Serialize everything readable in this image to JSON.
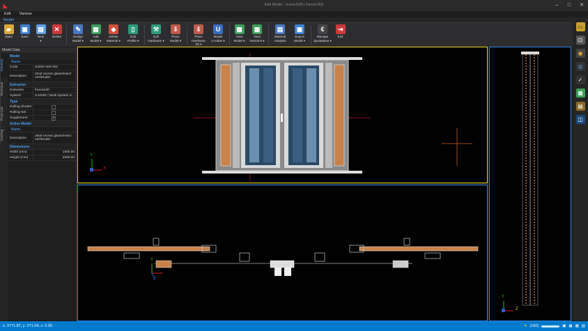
{
  "window": {
    "title": "Edit Model - frameSoft | frameCAD",
    "controls": [
      "–",
      "□",
      "✕"
    ]
  },
  "menu": [
    "Edit",
    "Various"
  ],
  "ribbon_tab": "Model",
  "ribbon": [
    {
      "label": "Open",
      "icon": "folder-icon",
      "color": "#d9a53a",
      "glyph": "▰"
    },
    {
      "label": "Save",
      "icon": "save-icon",
      "color": "#3b7fd4",
      "glyph": "▣"
    },
    {
      "label": "New\n▾",
      "icon": "new-icon",
      "color": "#5f9ee6",
      "glyph": "▤"
    },
    {
      "label": "Delete",
      "icon": "delete-icon",
      "color": "#c93b3b",
      "glyph": "✕"
    },
    {
      "label": "Design\nModel ▾",
      "icon": "design-model-icon",
      "color": "#4a78c2",
      "glyph": "✎"
    },
    {
      "label": "Add\nModel ▾",
      "icon": "add-model-icon",
      "color": "#3aa05a",
      "glyph": "▦"
    },
    {
      "label": "Delete\nMaterial ▾",
      "icon": "delete-material-icon",
      "color": "#d0503a",
      "glyph": "◆"
    },
    {
      "label": "Edit\nProfile ▾",
      "icon": "edit-profile-icon",
      "color": "#2f9a7a",
      "glyph": "▯"
    },
    {
      "label": "Edit\nHardware ▾",
      "icon": "edit-hardware-icon",
      "color": "#2f9a7a",
      "glyph": "⚒"
    },
    {
      "label": "Place\nModel ▾",
      "icon": "place-model-icon",
      "color": "#c05a4a",
      "glyph": "⇩"
    },
    {
      "label": "Place\nHardware 3D ▾",
      "icon": "place-hardware-icon",
      "color": "#c05a4a",
      "glyph": "⇩"
    },
    {
      "label": "Model\nU-value ▾",
      "icon": "u-value-icon",
      "color": "#3a6fc2",
      "glyph": "U"
    },
    {
      "label": "View\nModel ▾",
      "icon": "view-model-icon",
      "color": "#3aa05a",
      "glyph": "▦"
    },
    {
      "label": "View\nSections ▾",
      "icon": "view-sections-icon",
      "color": "#3aa05a",
      "glyph": "▦"
    },
    {
      "label": "Material\nAnalysis",
      "icon": "material-analysis-icon",
      "color": "#4a78c2",
      "glyph": "▤"
    },
    {
      "label": "Export\nModel ▾",
      "icon": "export-model-icon",
      "color": "#3b7fd4",
      "glyph": "▣"
    },
    {
      "label": "Manage\nQuotations ▾",
      "icon": "quotations-icon",
      "color": "#444",
      "glyph": "€"
    },
    {
      "label": "Exit",
      "icon": "exit-icon",
      "color": "#c93b3b",
      "glyph": "⇥"
    }
  ],
  "panel": {
    "title": "Model Data",
    "tabs": [
      "General",
      "Technical",
      "Price List",
      "Costing"
    ],
    "sections": {
      "model": "Model",
      "name": "Name",
      "code_label": "Code",
      "code": "S3200-400-002",
      "desc_label": "Description",
      "desc": "2leaf recess glass/insect net/shutter",
      "extrusion": "Extrusion",
      "extrusion_label": "Extrusion",
      "extrusion_value": "frameSoft",
      "system_label": "System",
      "system_value": "G10000 | Multi System S...",
      "type": "Type",
      "rolling_shutter": "Rolling Shutter",
      "rolling_net": "Rolling Net",
      "supplement": "Supplement",
      "supplement_check": "✓",
      "active_model": "Active Model",
      "name2": "Name",
      "desc2_label": "Description",
      "desc2": "2leaf recess glass/insect net/shutter",
      "dimensions": "Dimensions",
      "width_label": "Width (mm)",
      "width": "1500.00",
      "height_label": "Height (mm)",
      "height": "2000.00"
    }
  },
  "axes": {
    "x": "X",
    "y": "Y",
    "z": "Z"
  },
  "status": {
    "coords": "x: 3771.87, y: 271.04, z: 0.00",
    "zoom": "(160)"
  }
}
